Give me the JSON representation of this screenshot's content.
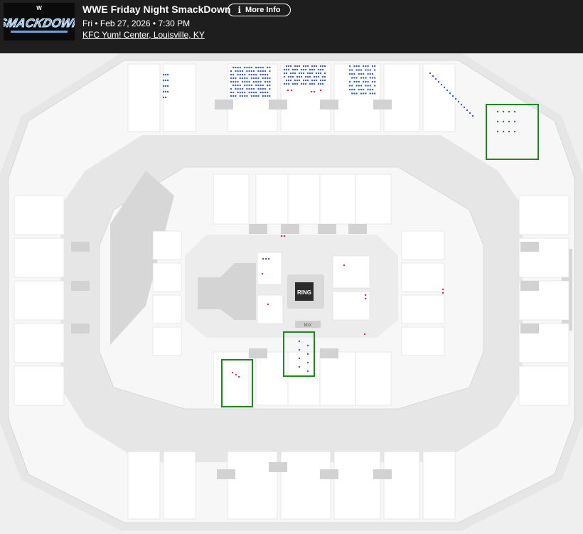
{
  "event": {
    "title": "WWE Friday Night SmackDown",
    "date_line": "Fri • Feb 27, 2026 • 7:30 PM",
    "venue": "KFC Yum! Center, Louisville, KY",
    "more_info_label": "More Info",
    "logo_text": "SMACKDOWN",
    "logo_badge": "W"
  },
  "map": {
    "ring_label": "RING",
    "mix_label": "MIX",
    "colors": {
      "available_seat": "#3b5bd9",
      "featured_seat": "#e0245e",
      "highlight_box": "#1a8a1a",
      "section_fill": "#ffffff",
      "arena_floor": "#e2e2e2"
    }
  }
}
